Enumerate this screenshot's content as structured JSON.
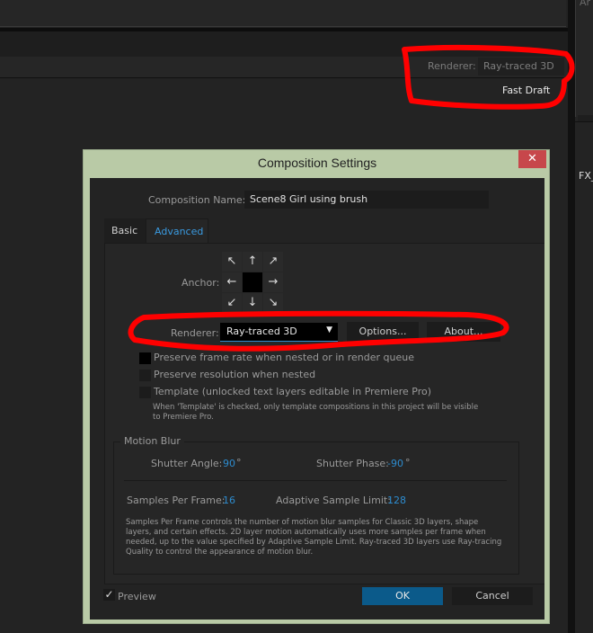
{
  "background": {
    "renderer_label": "Renderer:",
    "renderer_value": "Ray-traced 3D",
    "fast_draft": "Fast Draft",
    "right_panel_top": "Ar",
    "right_panel_tab": "FX_"
  },
  "dialog": {
    "title": "Composition Settings",
    "close": "✕",
    "comp_name_label": "Composition Name:",
    "comp_name_value": "Scene8 Girl using brush",
    "tabs": [
      {
        "label": "Basic",
        "active": false
      },
      {
        "label": "Advanced",
        "active": true
      }
    ],
    "anchor_label": "Anchor:",
    "anchor_arrows": [
      "↖",
      "↑",
      "↗",
      "←",
      "",
      "→",
      "↙",
      "↓",
      "↘"
    ],
    "renderer_label": "Renderer:",
    "renderer_value": "Ray-traced 3D",
    "options_button": "Options...",
    "about_button": "About...",
    "checkboxes": [
      {
        "label": "Preserve frame rate when nested or in render queue",
        "checked": false
      },
      {
        "label": "Preserve resolution when nested",
        "checked": false
      },
      {
        "label": "Template (unlocked text layers editable in Premiere Pro)",
        "checked": false
      }
    ],
    "template_note": "When 'Template' is checked, only template compositions in this project will be visible to Premiere Pro.",
    "motion_blur": {
      "title": "Motion Blur",
      "shutter_angle_label": "Shutter Angle:",
      "shutter_angle_value": "90",
      "shutter_angle_unit": "°",
      "shutter_phase_label": "Shutter Phase:",
      "shutter_phase_value": "-90",
      "shutter_phase_unit": "°",
      "samples_label": "Samples Per Frame:",
      "samples_value": "16",
      "adaptive_label": "Adaptive Sample Limit:",
      "adaptive_value": "128",
      "description": "Samples Per Frame controls the number of motion blur samples for Classic 3D layers, shape layers, and certain effects. 2D layer motion automatically uses more samples per frame when needed, up to the value specified by Adaptive Sample Limit. Ray-traced 3D layers use Ray-tracing Quality to control the appearance of motion blur."
    },
    "preview_label": "Preview",
    "preview_checked": true,
    "preview_check": "✓",
    "ok_button": "OK",
    "cancel_button": "Cancel"
  },
  "colors": {
    "title_bar": "#b9caa6",
    "close": "#c7474b",
    "ok": "#0b5a8a",
    "accent": "#2d8ccf",
    "annotation": "#ff0000"
  }
}
